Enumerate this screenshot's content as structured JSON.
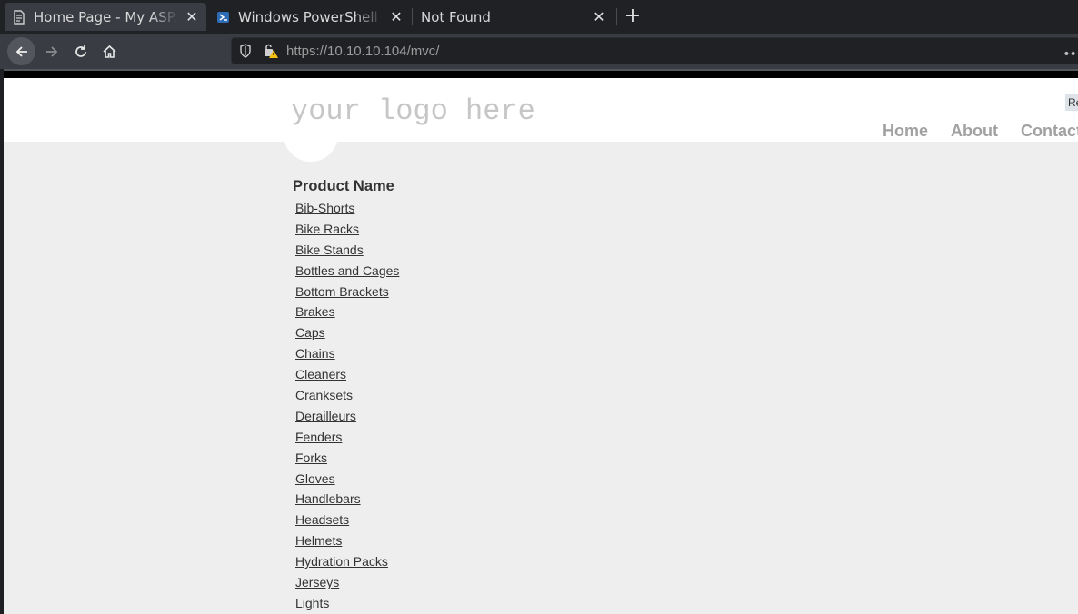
{
  "browser": {
    "tabs": [
      {
        "title": "Home Page - My ASP.NET",
        "icon": "page-icon",
        "active": true
      },
      {
        "title": "Windows PowerShell Web",
        "icon": "powershell-icon",
        "active": false
      },
      {
        "title": "Not Found",
        "icon": "none",
        "active": false
      }
    ],
    "new_tab_glyph": "+",
    "close_glyph": "✕",
    "url_host": "https://10.10.10.104",
    "url_path": "/mvc/",
    "more_glyph": "•••"
  },
  "site": {
    "logo_text": "your logo here",
    "register_label": "Re",
    "menu": [
      "Home",
      "About",
      "Contact"
    ]
  },
  "products": {
    "heading": "Product Name",
    "items": [
      "Bib-Shorts",
      "Bike Racks",
      "Bike Stands",
      "Bottles and Cages",
      "Bottom Brackets",
      "Brakes",
      "Caps",
      "Chains",
      "Cleaners",
      "Cranksets",
      "Derailleurs",
      "Fenders",
      "Forks",
      "Gloves",
      "Handlebars",
      "Headsets",
      "Helmets",
      "Hydration Packs",
      "Jerseys",
      "Lights"
    ]
  }
}
